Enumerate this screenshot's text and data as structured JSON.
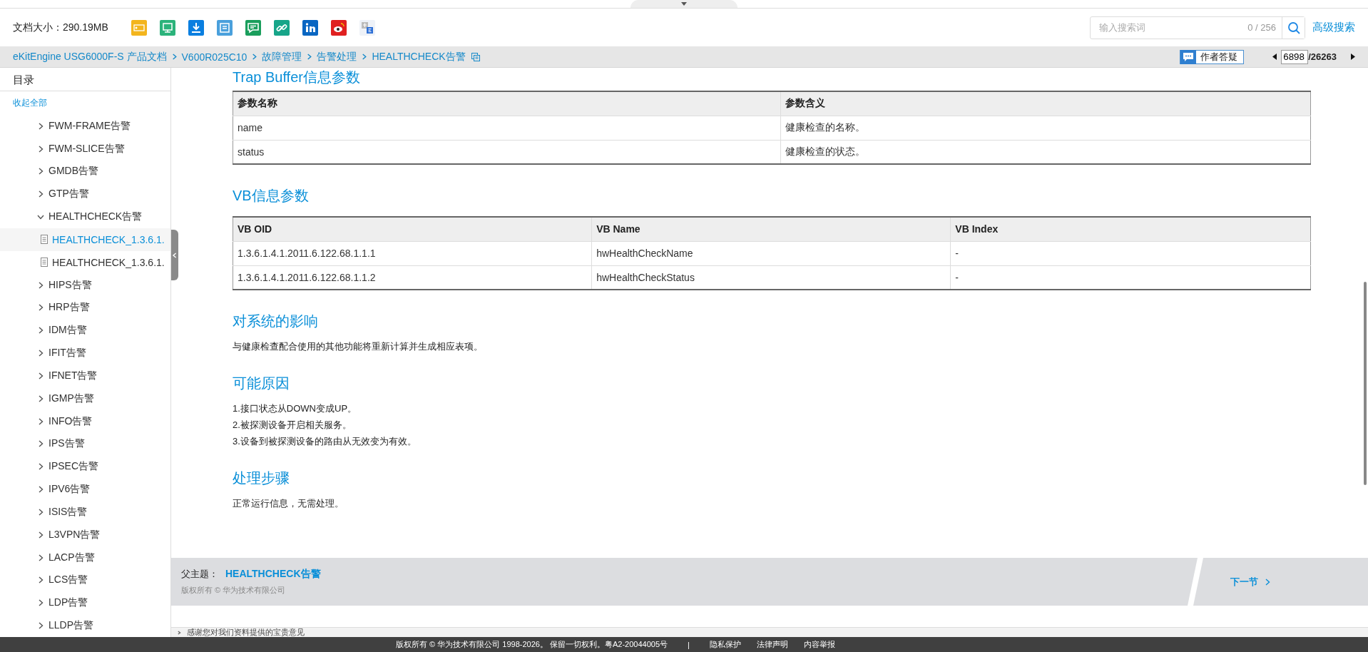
{
  "header": {
    "file_size_label": "文档大小：",
    "file_size": "290.19MB",
    "search": {
      "placeholder": "输入搜索词",
      "counter": "0 / 256"
    },
    "advanced_search": "高级搜索"
  },
  "breadcrumb": [
    "eKitEngine USG6000F-S 产品文档",
    "V600R025C10",
    "故障管理",
    "告警处理",
    "HEALTHCHECK告警"
  ],
  "ask_author": "作者答疑",
  "pager": {
    "current": "6898",
    "total": "/26263"
  },
  "sidebar": {
    "title": "目录",
    "collapse_all": "收起全部",
    "items": [
      {
        "label": "FWM-FRAME告警",
        "expanded": false,
        "selected": false
      },
      {
        "label": "FWM-SLICE告警",
        "expanded": false,
        "selected": false
      },
      {
        "label": "GMDB告警",
        "expanded": false,
        "selected": false
      },
      {
        "label": "GTP告警",
        "expanded": false,
        "selected": false
      },
      {
        "label": "HEALTHCHECK告警",
        "expanded": true,
        "selected": false,
        "children": [
          {
            "label": "HEALTHCHECK_1.3.6.1.",
            "selected": true
          },
          {
            "label": "HEALTHCHECK_1.3.6.1.",
            "selected": false
          }
        ]
      },
      {
        "label": "HIPS告警",
        "expanded": false,
        "selected": false
      },
      {
        "label": "HRP告警",
        "expanded": false,
        "selected": false
      },
      {
        "label": "IDM告警",
        "expanded": false,
        "selected": false
      },
      {
        "label": "IFIT告警",
        "expanded": false,
        "selected": false
      },
      {
        "label": "IFNET告警",
        "expanded": false,
        "selected": false
      },
      {
        "label": "IGMP告警",
        "expanded": false,
        "selected": false
      },
      {
        "label": "INFO告警",
        "expanded": false,
        "selected": false
      },
      {
        "label": "IPS告警",
        "expanded": false,
        "selected": false
      },
      {
        "label": "IPSEC告警",
        "expanded": false,
        "selected": false
      },
      {
        "label": "IPV6告警",
        "expanded": false,
        "selected": false
      },
      {
        "label": "ISIS告警",
        "expanded": false,
        "selected": false
      },
      {
        "label": "L3VPN告警",
        "expanded": false,
        "selected": false
      },
      {
        "label": "LACP告警",
        "expanded": false,
        "selected": false
      },
      {
        "label": "LCS告警",
        "expanded": false,
        "selected": false
      },
      {
        "label": "LDP告警",
        "expanded": false,
        "selected": false
      },
      {
        "label": "LLDP告警",
        "expanded": false,
        "selected": false
      }
    ]
  },
  "sections": [
    {
      "kind": "table",
      "heading": "Trap Buffer信息参数",
      "columns": [
        "参数名称",
        "参数含义"
      ],
      "rows": [
        [
          "name",
          "健康检查的名称。"
        ],
        [
          "status",
          "健康检查的状态。"
        ]
      ]
    },
    {
      "kind": "table",
      "heading": "VB信息参数",
      "columns": [
        "VB OID",
        "VB Name",
        "VB Index"
      ],
      "rows": [
        [
          "1.3.6.1.4.1.2011.6.122.68.1.1.1",
          "hwHealthCheckName",
          "-"
        ],
        [
          "1.3.6.1.4.1.2011.6.122.68.1.1.2",
          "hwHealthCheckStatus",
          "-"
        ]
      ]
    },
    {
      "kind": "text",
      "heading": "对系统的影响",
      "lines": [
        "与健康检查配合使用的其他功能将重新计算并生成相应表项。"
      ]
    },
    {
      "kind": "text",
      "heading": "可能原因",
      "lines": [
        "1.接口状态从DOWN变成UP。",
        "2.被探测设备开启相关服务。",
        "3.设备到被探测设备的路由从无效变为有效。"
      ]
    },
    {
      "kind": "text",
      "heading": "处理步骤",
      "lines": [
        "正常运行信息，无需处理。"
      ]
    }
  ],
  "doc_footer": {
    "parent_label": "父主题：",
    "parent_link": "HEALTHCHECK告警",
    "copyright": "版权所有 © 华为技术有限公司",
    "next": "下一节"
  },
  "feedback": "感谢您对我们资料提供的宝贵意见",
  "site_footer": {
    "copyright": "版权所有 © 华为技术有限公司 1998-2026。 保留一切权利。粤A2-20044005号",
    "separator": "|",
    "links": [
      "隐私保护",
      "法律声明",
      "内容举报"
    ]
  }
}
